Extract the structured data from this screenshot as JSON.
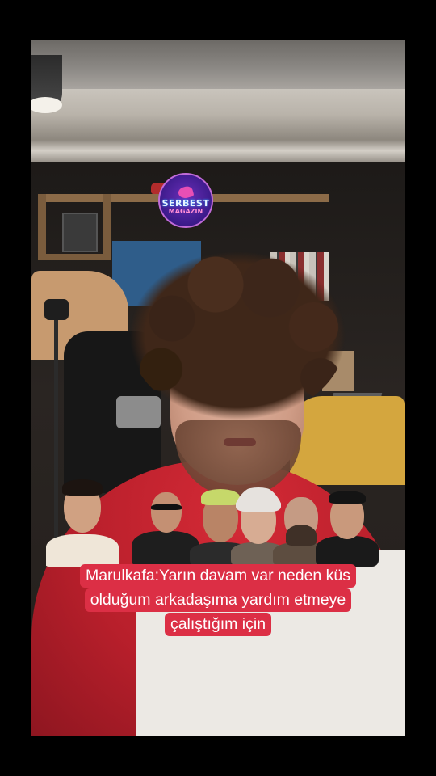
{
  "watermark": {
    "line1": "SERBEST",
    "line2": "MAGAZIN"
  },
  "caption": {
    "lines": [
      "Marulkafa:Yarın davam var neden küs",
      "olduğum arkadaşıma yardım etmeye",
      "çalıştığım için"
    ]
  },
  "colors": {
    "caption_bg": "#dc2f45",
    "caption_text": "#ffffff",
    "hoodie": "#c8232f"
  }
}
